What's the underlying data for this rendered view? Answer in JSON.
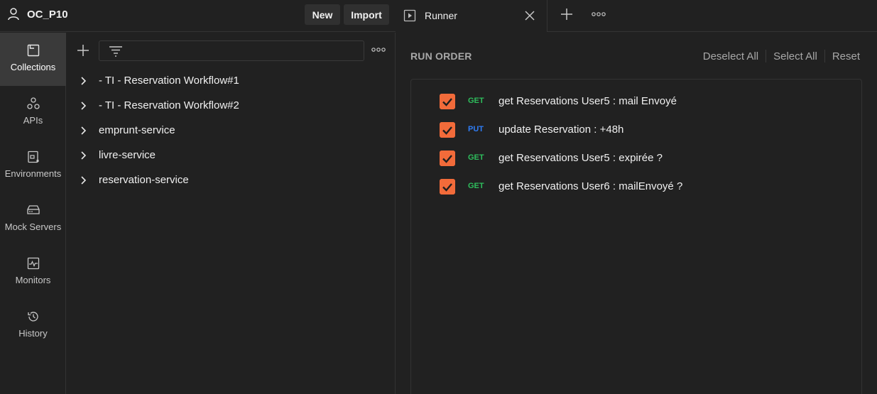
{
  "workspace": {
    "name": "OC_P10",
    "new_label": "New",
    "import_label": "Import"
  },
  "nav": {
    "items": [
      {
        "label": "Collections",
        "icon": "collections-icon",
        "active": true
      },
      {
        "label": "APIs",
        "icon": "apis-icon"
      },
      {
        "label": "Environments",
        "icon": "environments-icon"
      },
      {
        "label": "Mock Servers",
        "icon": "mock-servers-icon"
      },
      {
        "label": "Monitors",
        "icon": "monitors-icon"
      },
      {
        "label": "History",
        "icon": "history-icon"
      }
    ]
  },
  "sidebar": {
    "filter_value": "",
    "collections": [
      {
        "name": "- TI - Reservation Workflow#1"
      },
      {
        "name": "- TI - Reservation Workflow#2"
      },
      {
        "name": "emprunt-service"
      },
      {
        "name": "livre-service"
      },
      {
        "name": "reservation-service"
      }
    ]
  },
  "tabs": [
    {
      "label": "Runner",
      "icon": "runner-play-icon"
    }
  ],
  "runner": {
    "title": "RUN ORDER",
    "deselect_all": "Deselect All",
    "select_all": "Select All",
    "reset": "Reset",
    "requests": [
      {
        "method": "GET",
        "name": "get Reservations User5 : mail Envoyé",
        "checked": true
      },
      {
        "method": "PUT",
        "name": "update Reservation : +48h",
        "checked": true
      },
      {
        "method": "GET",
        "name": "get Reservations User5 : expirée ?",
        "checked": true
      },
      {
        "method": "GET",
        "name": "get Reservations User6 : mailEnvoyé ?",
        "checked": true
      }
    ]
  },
  "colors": {
    "background": "#212121",
    "accent_orange": "#f26b3a",
    "method_get": "#2ebd5c",
    "method_put": "#2f7df6",
    "muted_text": "#a8a8a8"
  }
}
